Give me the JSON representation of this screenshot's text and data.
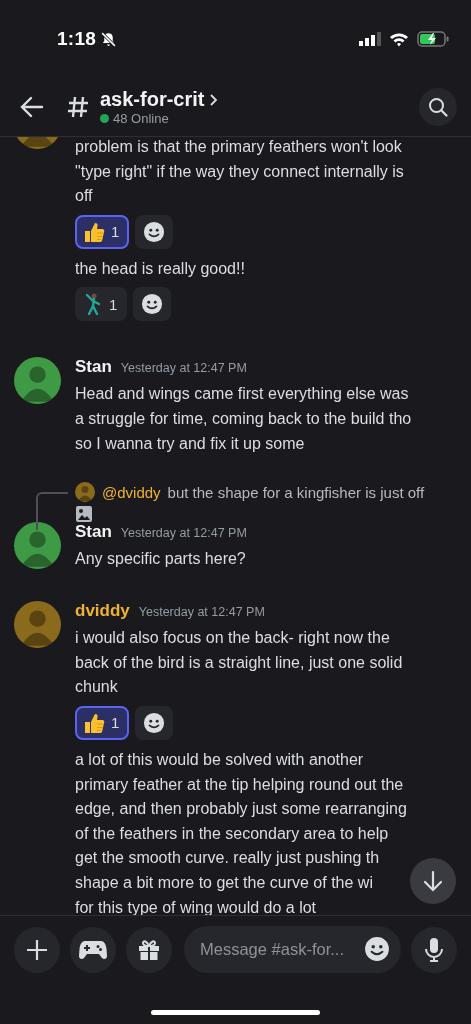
{
  "status_bar": {
    "time": "1:18"
  },
  "header": {
    "channel": "ask-for-crit",
    "online": "48 Online"
  },
  "messages": [
    {
      "avatar": {
        "color": "#8a6a1c"
      },
      "cut": true,
      "blocks": [
        {
          "text": "problem is that the primary feathers won't look\n\"type right\" if the way they connect internally is\noff",
          "reactions": [
            {
              "kind": "thumbs",
              "count": "1",
              "selected": true
            }
          ]
        },
        {
          "text": "the head is really good!!",
          "reactions": [
            {
              "kind": "figure",
              "count": "1",
              "selected": false
            }
          ]
        }
      ]
    },
    {
      "avatar": {
        "color": "#3f9a45"
      },
      "author": {
        "name": "Stan",
        "color": "#f2f3f5"
      },
      "time": "Yesterday at 12:47 PM",
      "blocks": [
        {
          "text": "Head and wings came first everything else was\na struggle for time, coming back to the build tho\nso I wanna try and fix it up some"
        }
      ]
    },
    {
      "avatar": {
        "color": "#3f9a45"
      },
      "author": {
        "name": "Stan",
        "color": "#f2f3f5"
      },
      "time": "Yesterday at 12:47 PM",
      "reply": {
        "avatar": {
          "color": "#8a6a1c"
        },
        "mention": "@dviddy",
        "text": "but the shape for a kingfisher is just off"
      },
      "blocks": [
        {
          "text": "Any specific parts here?"
        }
      ]
    },
    {
      "avatar": {
        "color": "#8a6a1c"
      },
      "author": {
        "name": "dviddy",
        "color": "#f0b232"
      },
      "time": "Yesterday at 12:47 PM",
      "blocks": [
        {
          "text": "i would also focus on the back- right now the\nback of the bird is a straight line, just one solid\nchunk",
          "reactions": [
            {
              "kind": "thumbs",
              "count": "1",
              "selected": true
            }
          ]
        },
        {
          "text": "a lot of this would be solved with another\nprimary feather at the tip helping round out the\nedge, and then probably just some rearranging\nof the feathers in the secondary area to help\nget the smooth curve. really just pushing th\nshape a bit more to get the curve of the wi\nfor this type of wing would do a lot"
        }
      ]
    }
  ],
  "composer": {
    "placeholder": "Message #ask-for..."
  }
}
